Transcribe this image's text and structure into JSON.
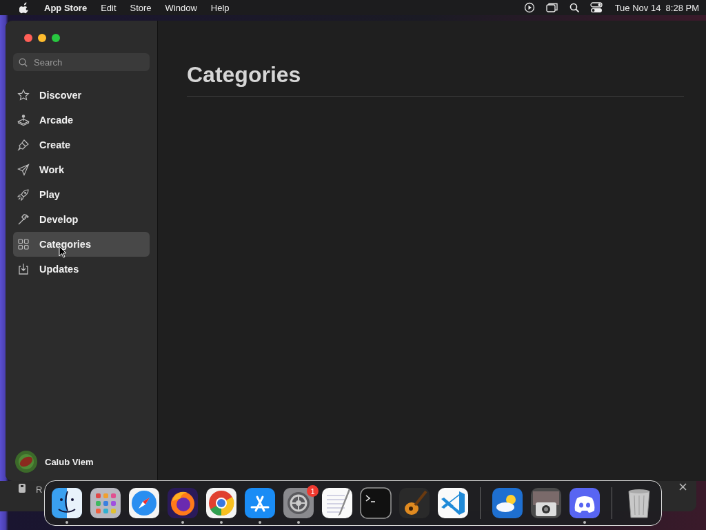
{
  "menu_bar": {
    "app_name": "App Store",
    "menus": [
      "Edit",
      "Store",
      "Window",
      "Help"
    ],
    "clock": "Tue Nov 14  8:28 PM"
  },
  "window": {
    "search": {
      "placeholder": "Search"
    },
    "sidebar": {
      "items": [
        {
          "label": "Discover",
          "kind": "star",
          "selected": false
        },
        {
          "label": "Arcade",
          "kind": "joystick",
          "selected": false
        },
        {
          "label": "Create",
          "kind": "brush",
          "selected": false
        },
        {
          "label": "Work",
          "kind": "plane",
          "selected": false
        },
        {
          "label": "Play",
          "kind": "rocket",
          "selected": false
        },
        {
          "label": "Develop",
          "kind": "hammer",
          "selected": false
        },
        {
          "label": "Categories",
          "kind": "grid",
          "selected": true
        },
        {
          "label": "Updates",
          "kind": "download",
          "selected": false
        }
      ],
      "account": {
        "name": "Calub Viem"
      }
    },
    "content": {
      "title": "Categories"
    }
  },
  "background_window": {
    "title": "R"
  },
  "dock": {
    "items": [
      {
        "kind": "finder",
        "running": true
      },
      {
        "kind": "launchpad",
        "running": false
      },
      {
        "kind": "safari",
        "running": false
      },
      {
        "kind": "firefox",
        "running": true
      },
      {
        "kind": "chrome",
        "running": true
      },
      {
        "kind": "appstore",
        "running": true
      },
      {
        "kind": "settings",
        "running": true,
        "badge": "1"
      },
      {
        "kind": "textedit",
        "running": false
      },
      {
        "kind": "terminal",
        "running": false
      },
      {
        "kind": "garageband",
        "running": false
      },
      {
        "kind": "vscode",
        "running": false
      },
      {
        "kind": "separator"
      },
      {
        "kind": "weather",
        "running": false
      },
      {
        "kind": "screenshot",
        "running": false
      },
      {
        "kind": "discord",
        "running": true
      },
      {
        "kind": "separator"
      },
      {
        "kind": "trash",
        "running": false
      }
    ]
  }
}
